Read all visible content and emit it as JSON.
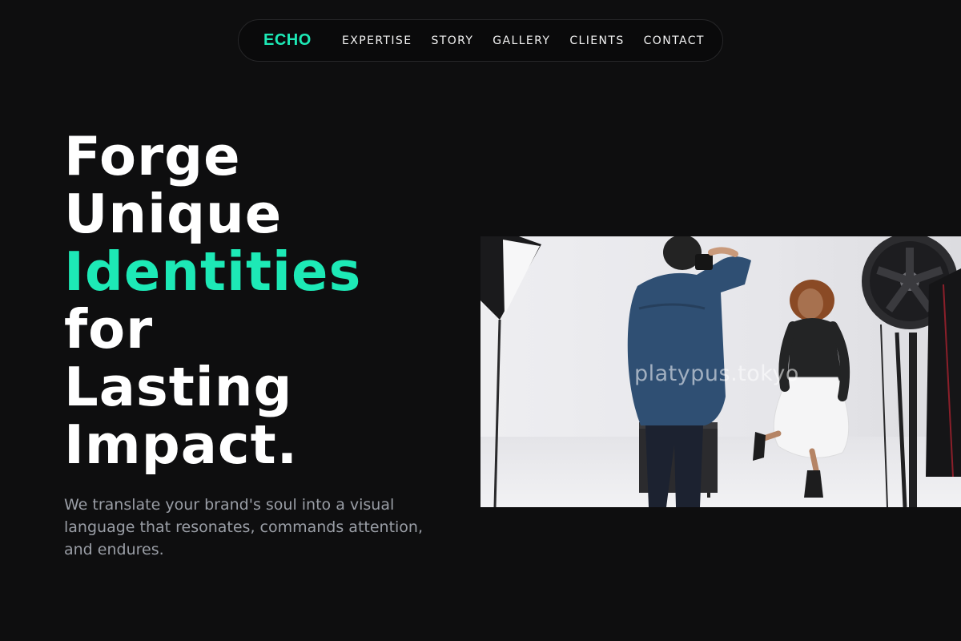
{
  "nav": {
    "logo": "ECHO",
    "links": [
      "EXPERTISE",
      "STORY",
      "GALLERY",
      "CLIENTS",
      "CONTACT"
    ]
  },
  "hero": {
    "headline_lines": [
      "Forge",
      "Unique",
      "Identities",
      "for",
      "Lasting",
      "Impact."
    ],
    "accent_line_index": 2,
    "subtext": "We translate your brand's soul into a visual language that resonates, commands attention, and endures.",
    "image_watermark": "platypus.tokyo"
  },
  "colors": {
    "background": "#0e0e0f",
    "accent": "#1de9b6",
    "text_primary": "#ffffff",
    "text_muted": "#9a9ea6"
  }
}
